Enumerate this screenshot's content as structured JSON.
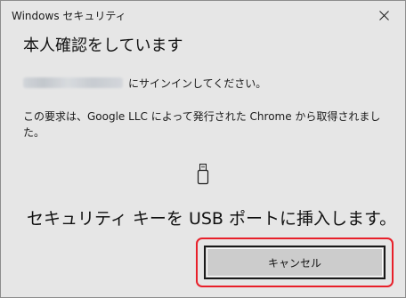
{
  "window": {
    "title": "Windows セキュリティ"
  },
  "dialog": {
    "heading": "本人確認をしています",
    "account_suffix": "にサインインしてください。",
    "request_text": "この要求は、Google LLC によって発行された Chrome から取得されました。",
    "usb_icon": "usb-key-icon",
    "instruction": "セキュリティ キーを USB ポートに挿入します。"
  },
  "buttons": {
    "cancel_label": "キャンセル"
  },
  "colors": {
    "background": "#e6e6e6",
    "focus_ring": "#e8202a",
    "button_fill": "#cccccc"
  }
}
